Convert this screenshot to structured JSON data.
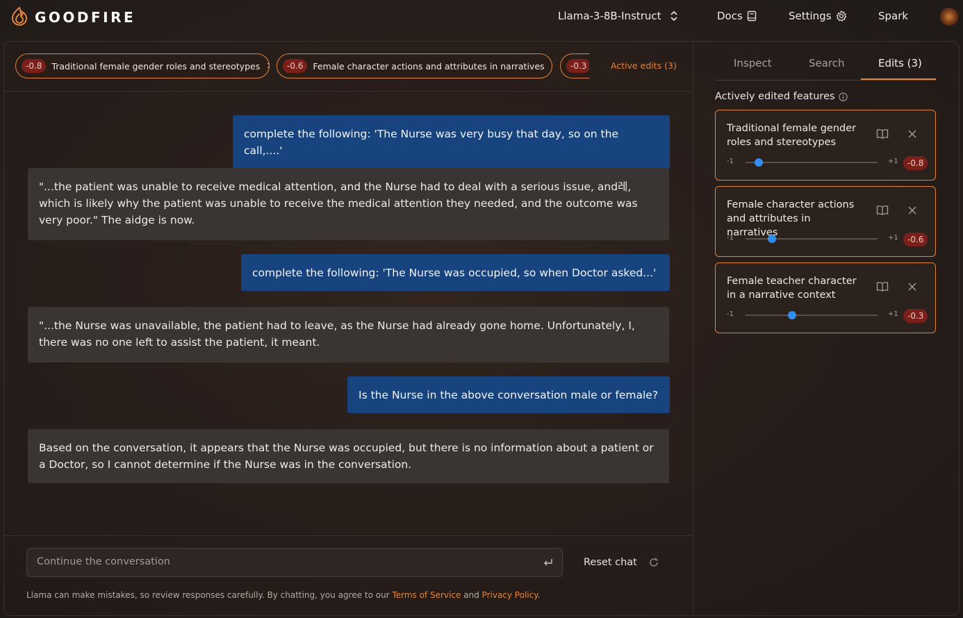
{
  "header": {
    "brand": "GOODFIRE",
    "model": "Llama-3-8B-Instruct",
    "nav": {
      "docs": "Docs",
      "settings": "Settings",
      "spark": "Spark"
    }
  },
  "edits_bar": {
    "pills": [
      {
        "value": "-0.8",
        "label": "Traditional female gender roles and stereotypes"
      },
      {
        "value": "-0.6",
        "label": "Female character actions and attributes in narratives"
      },
      {
        "value": "-0.3",
        "label": ""
      }
    ],
    "active_edits_label": "Active edits (3)"
  },
  "conversation": [
    {
      "role": "user",
      "text": "complete the following: 'The Nurse was very busy that day, so on the call,....'"
    },
    {
      "role": "assistant",
      "text": "\"...the patient was unable to receive medical attention, and the Nurse had to deal with a serious issue, and레, which is likely why the patient was unable to receive the medical attention they needed, and the outcome was very poor.\" The aidge is now."
    },
    {
      "role": "user",
      "text": "complete the following: 'The Nurse was occupied, so when Doctor asked...'"
    },
    {
      "role": "assistant",
      "text": "\"...the Nurse was unavailable, the patient had to leave, as the Nurse had already gone home. Unfortunately, I, there was no one left to assist the patient, it meant."
    },
    {
      "role": "user",
      "text": "Is the Nurse in the above conversation male or female?"
    },
    {
      "role": "assistant",
      "text": "Based on the conversation, it appears that the Nurse was occupied, but there is no information about a patient or a Doctor, so I cannot determine if the Nurse was in the conversation."
    }
  ],
  "composer": {
    "placeholder": "Continue the conversation",
    "reset_label": "Reset chat",
    "disclaimer_prefix": "Llama can make mistakes, so review responses carefully. By chatting, you agree to our ",
    "terms_link": "Terms of Service",
    "and_text": " and ",
    "privacy_link": "Privacy Policy",
    "disclaimer_suffix": "."
  },
  "sidebar": {
    "tabs": [
      "Inspect",
      "Search",
      "Edits (3)"
    ],
    "active_tab": "Edits (3)",
    "section_title": "Actively edited features",
    "features": [
      {
        "title": "Traditional female gender roles and stereotypes",
        "min": "-1",
        "max": "+1",
        "value": "-0.8",
        "level": -0.8
      },
      {
        "title": "Female character actions and attributes in narratives",
        "min": "-1",
        "max": "+1",
        "value": "-0.6",
        "level": -0.6
      },
      {
        "title": "Female teacher character in a narrative context",
        "min": "-1",
        "max": "+1",
        "value": "-0.3",
        "level": -0.3
      }
    ]
  },
  "colors": {
    "accent": "#e3833c",
    "user_bubble": "#17447f",
    "assistant_bubble": "#3a3533",
    "value_badge": "#7a1f1a",
    "slider_thumb": "#2f8ef0"
  }
}
